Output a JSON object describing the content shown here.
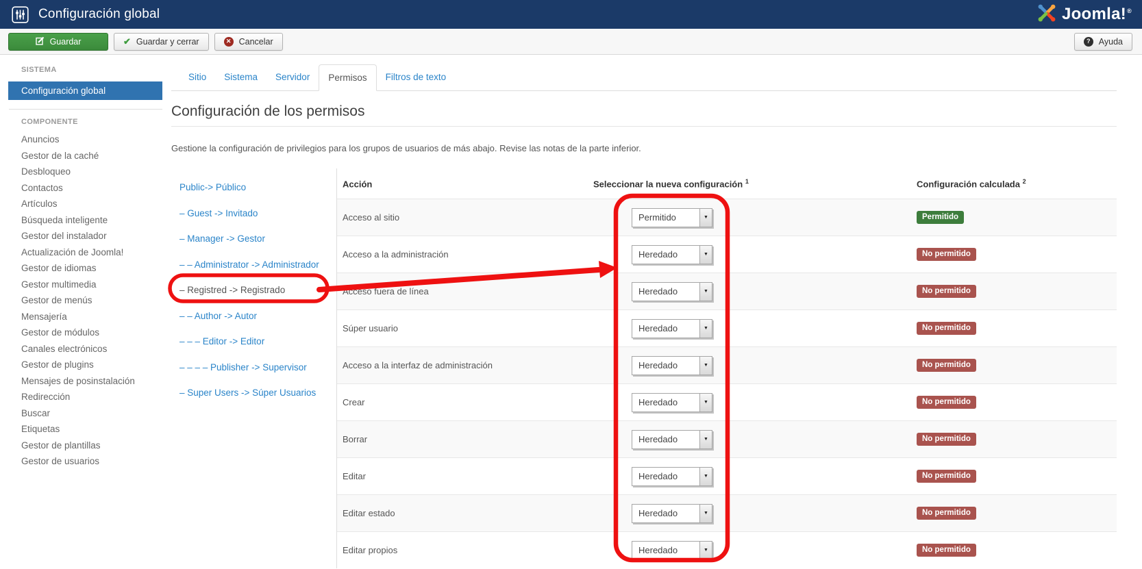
{
  "titlebar": {
    "title": "Configuración global",
    "logo_text": "Joomla!",
    "logo_reg": "®"
  },
  "toolbar": {
    "save_label": "Guardar",
    "save_close_label": "Guardar y cerrar",
    "cancel_label": "Cancelar",
    "help_label": "Ayuda",
    "check_glyph": "✔",
    "cancel_glyph": "✕",
    "help_glyph": "?"
  },
  "icons": {
    "titlebar": "sliders-icon",
    "logo": "joomla-pinwheel-icon",
    "save": "edit-icon",
    "save_close": "check-icon",
    "cancel": "cancel-circle-icon",
    "help": "question-circle-icon",
    "select": "dropdown-arrow-icon"
  },
  "colors": {
    "topbar_bg": "#1b3a68",
    "sidebar_active_bg": "#3073b0",
    "link_blue": "#2a84c9",
    "save_button_green": "#3b8a3b",
    "badge_allowed_green": "#3d7d3c",
    "badge_denied_red": "#a9534e",
    "annotation_red": "#ee1111"
  },
  "sidebar": {
    "system_header": "SISTEMA",
    "system_items": [
      {
        "label": "Configuración global",
        "active": true
      }
    ],
    "component_header": "COMPONENTE",
    "component_items": [
      "Anuncios",
      "Gestor de la caché",
      "Desbloqueo",
      "Contactos",
      "Artículos",
      "Búsqueda inteligente",
      "Gestor del instalador",
      "Actualización de Joomla!",
      "Gestor de idiomas",
      "Gestor multimedia",
      "Gestor de menús",
      "Mensajería",
      "Gestor de módulos",
      "Canales electrónicos",
      "Gestor de plugins",
      "Mensajes de posinstalación",
      "Redirección",
      "Buscar",
      "Etiquetas",
      "Gestor de plantillas",
      "Gestor de usuarios"
    ]
  },
  "tabs": [
    {
      "label": "Sitio",
      "active": false
    },
    {
      "label": "Sistema",
      "active": false
    },
    {
      "label": "Servidor",
      "active": false
    },
    {
      "label": "Permisos",
      "active": true
    },
    {
      "label": "Filtros de texto",
      "active": false
    }
  ],
  "permissions": {
    "heading": "Configuración de los permisos",
    "description": "Gestione la configuración de privilegios para los grupos de usuarios de más abajo. Revise las notas de la parte inferior.",
    "groups": [
      {
        "label": "Public-> Público",
        "active": false
      },
      {
        "label": "– Guest -> Invitado",
        "active": false
      },
      {
        "label": "– Manager -> Gestor",
        "active": false
      },
      {
        "label": "– – Administrator -> Administrador",
        "active": false
      },
      {
        "label": "– Registred -> Registrado",
        "active": true
      },
      {
        "label": "– – Author -> Autor",
        "active": false
      },
      {
        "label": "– – – Editor -> Editor",
        "active": false
      },
      {
        "label": "– – – – Publisher -> Supervisor",
        "active": false
      },
      {
        "label": "– Super Users -> Súper Usuarios",
        "active": false
      }
    ],
    "table": {
      "columns": [
        {
          "label": "Acción",
          "sup": ""
        },
        {
          "label": "Seleccionar la nueva configuración",
          "sup": "1"
        },
        {
          "label": "Configuración calculada",
          "sup": "2"
        }
      ],
      "rows": [
        {
          "action": "Acceso al sitio",
          "select": "Permitido",
          "status": "Permitido",
          "status_type": "allowed"
        },
        {
          "action": "Acceso a la administración",
          "select": "Heredado",
          "status": "No permitido",
          "status_type": "denied"
        },
        {
          "action": "Acceso fuera de línea",
          "select": "Heredado",
          "status": "No permitido",
          "status_type": "denied"
        },
        {
          "action": "Súper usuario",
          "select": "Heredado",
          "status": "No permitido",
          "status_type": "denied"
        },
        {
          "action": "Acceso a la interfaz de administración",
          "select": "Heredado",
          "status": "No permitido",
          "status_type": "denied"
        },
        {
          "action": "Crear",
          "select": "Heredado",
          "status": "No permitido",
          "status_type": "denied"
        },
        {
          "action": "Borrar",
          "select": "Heredado",
          "status": "No permitido",
          "status_type": "denied"
        },
        {
          "action": "Editar",
          "select": "Heredado",
          "status": "No permitido",
          "status_type": "denied"
        },
        {
          "action": "Editar estado",
          "select": "Heredado",
          "status": "No permitido",
          "status_type": "denied"
        },
        {
          "action": "Editar propios",
          "select": "Heredado",
          "status": "No permitido",
          "status_type": "denied"
        }
      ]
    }
  },
  "annotations": {
    "circle_target": "registered-group-item",
    "box_target": "select-column",
    "arrow_from": "registered-group-item",
    "arrow_to": "select-column"
  }
}
